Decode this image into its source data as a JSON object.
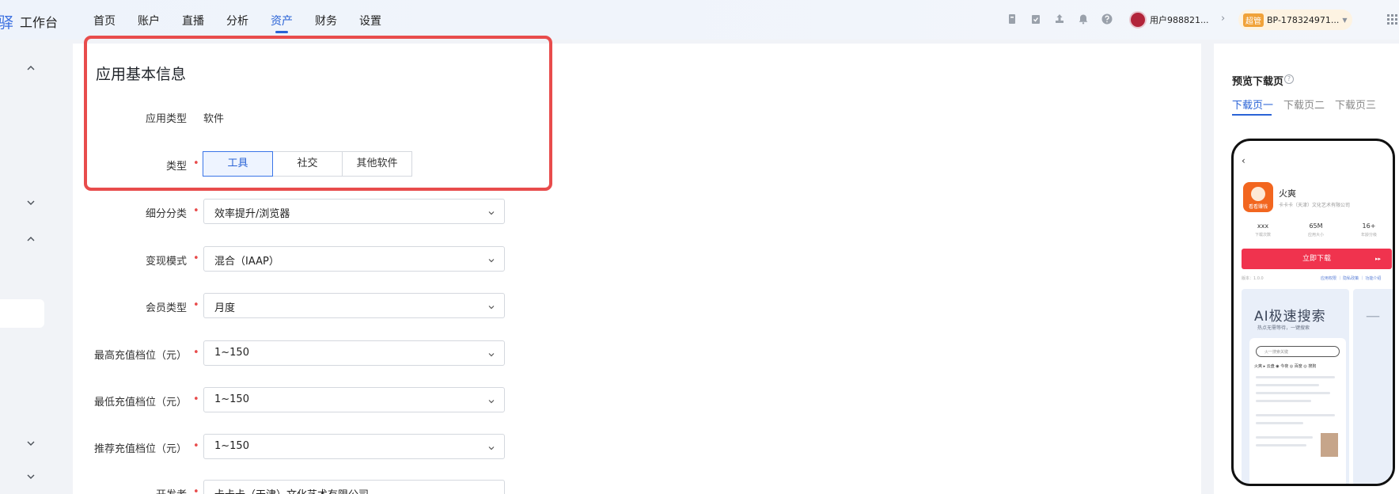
{
  "topbar": {
    "brand_fragment": "驿",
    "brand": "工作台",
    "nav": [
      "首页",
      "账户",
      "直播",
      "分析",
      "资产",
      "财务",
      "设置"
    ],
    "active_nav": "资产",
    "user_name": "用户988821...",
    "bp_badge": "超管",
    "bp_text": "BP-178324971..."
  },
  "form": {
    "section_title": "应用基本信息",
    "app_type_label": "应用类型",
    "app_type_value": "软件",
    "type_label": "类型",
    "type_options": [
      "工具",
      "社交",
      "其他软件"
    ],
    "type_selected": "工具",
    "subcategory_label": "细分分类",
    "subcategory_value": "效率提升/浏览器",
    "monetization_label": "变现模式",
    "monetization_value": "混合（IAAP）",
    "member_label": "会员类型",
    "member_value": "月度",
    "max_recharge_label": "最高充值档位（元）",
    "max_recharge_value": "1~150",
    "min_recharge_label": "最低充值档位（元）",
    "min_recharge_value": "1~150",
    "rec_recharge_label": "推荐充值档位（元）",
    "rec_recharge_value": "1~150",
    "developer_label": "开发者",
    "developer_value": "卡卡卡（天津）文化艺术有限公司"
  },
  "preview": {
    "title": "预览下载页",
    "help_icon": "?",
    "tabs": [
      "下载页一",
      "下载页二",
      "下载页三"
    ],
    "active_tab": "下载页一",
    "phone": {
      "back": "‹",
      "app_name": "火爽",
      "app_icon_tag": "看看赚钱",
      "company": "卡卡卡（天津）文化艺术有限公司",
      "stats": [
        {
          "value": "xxx",
          "label": "下载次数"
        },
        {
          "value": "65M",
          "label": "应用大小"
        },
        {
          "value": "16+",
          "label": "年龄分级"
        }
      ],
      "download_button": "立即下载",
      "download_arrow": "▸▸",
      "version": "版本：1.0.0",
      "links": "应用权限 ｜ 隐私政策 ｜ 功能介绍",
      "card_title": "AI极速搜索",
      "card_subtitle": "热点无需等待，一键搜索",
      "card2_char": "一",
      "search_placeholder": "火一搜索关键",
      "chips": "火爽  ▸ 云盘  ◉ 今夜  ◎ 百度  ◎ 搜狗"
    }
  },
  "colors": {
    "accent": "#2a63d6",
    "highlight": "#e84c4c",
    "download_button": "#f0334e"
  }
}
